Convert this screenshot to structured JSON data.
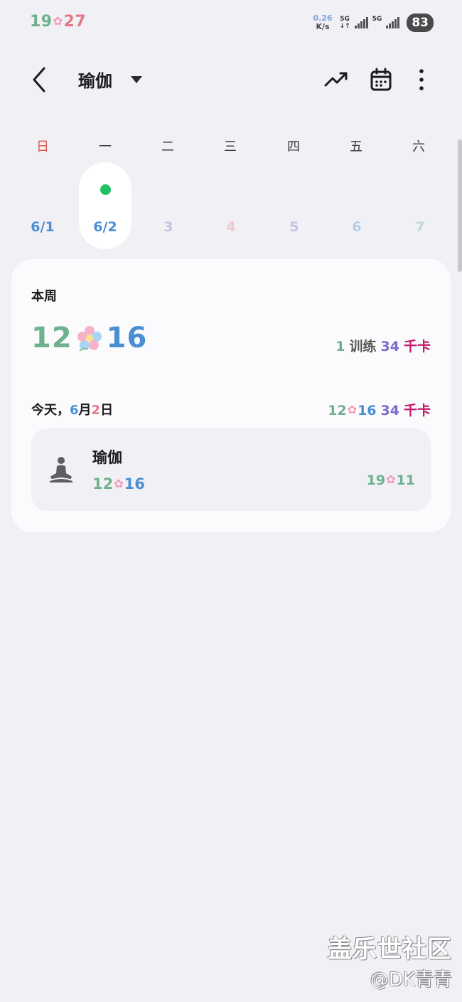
{
  "status_bar": {
    "time_h": "19",
    "time_m": "27",
    "net_speed": "0.26",
    "net_unit": "K/s",
    "net1": "5G",
    "net2": "5G",
    "battery": "83"
  },
  "header": {
    "title": "瑜伽",
    "icons": [
      "back-icon",
      "dropdown-caret-icon",
      "trend-icon",
      "calendar-icon",
      "more-icon"
    ]
  },
  "week": {
    "days": [
      "日",
      "一",
      "二",
      "三",
      "四",
      "五",
      "六"
    ],
    "dates": [
      "6/1",
      "6/2",
      "3",
      "4",
      "5",
      "6",
      "7"
    ],
    "selected_index": 1
  },
  "summary": {
    "label": "本周",
    "duration_h": "12",
    "duration_m": "16",
    "sessions": "1",
    "sessions_unit": "训练",
    "calories": "34",
    "calories_unit": "千卡"
  },
  "today": {
    "label_prefix": "今天，",
    "month": "6",
    "month_unit": "月",
    "day": "2",
    "day_unit": "日",
    "duration_h": "12",
    "duration_m": "16",
    "calories": "34",
    "calories_unit": "千卡"
  },
  "workout": {
    "name": "瑜伽",
    "duration_h": "12",
    "duration_m": "16",
    "time_h": "19",
    "time_m": "11",
    "icon": "yoga-icon"
  },
  "watermark": {
    "main": "盖乐世社区",
    "sub": "@DK青青"
  },
  "colors": {
    "accent_green": "#21c063",
    "sunday_red": "#d9534f",
    "calorie_magenta": "#c2186b"
  }
}
